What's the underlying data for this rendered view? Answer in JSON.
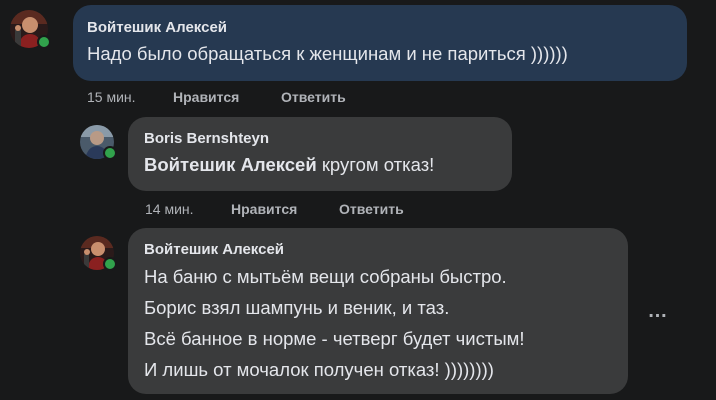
{
  "comments": [
    {
      "author": "Войтешик Алексей",
      "text": "Надо было обращаться к женщинам и не париться ))))))",
      "time": "15 мин.",
      "like_label": "Нравится",
      "reply_label": "Ответить",
      "online": true
    },
    {
      "author": "Boris Bernshteyn",
      "mention": "Войтешик Алексей",
      "text": " кругом отказ!",
      "time": "14 мин.",
      "like_label": "Нравится",
      "reply_label": "Ответить",
      "online": true
    },
    {
      "author": "Войтешик Алексей",
      "lines": [
        "На баню с мытьём вещи собраны быстро.",
        "Борис взял шампунь и веник, и таз.",
        "Всё банное в норме - четверг будет чистым!",
        "И лишь от мочалок получен отказ! ))))))))"
      ],
      "online": true
    }
  ],
  "more_icon": "…",
  "colors": {
    "background": "#18191a",
    "bubble_highlight": "#263951",
    "bubble": "#3a3b3c",
    "online": "#31a24c",
    "meta_text": "#b0b3b8"
  }
}
